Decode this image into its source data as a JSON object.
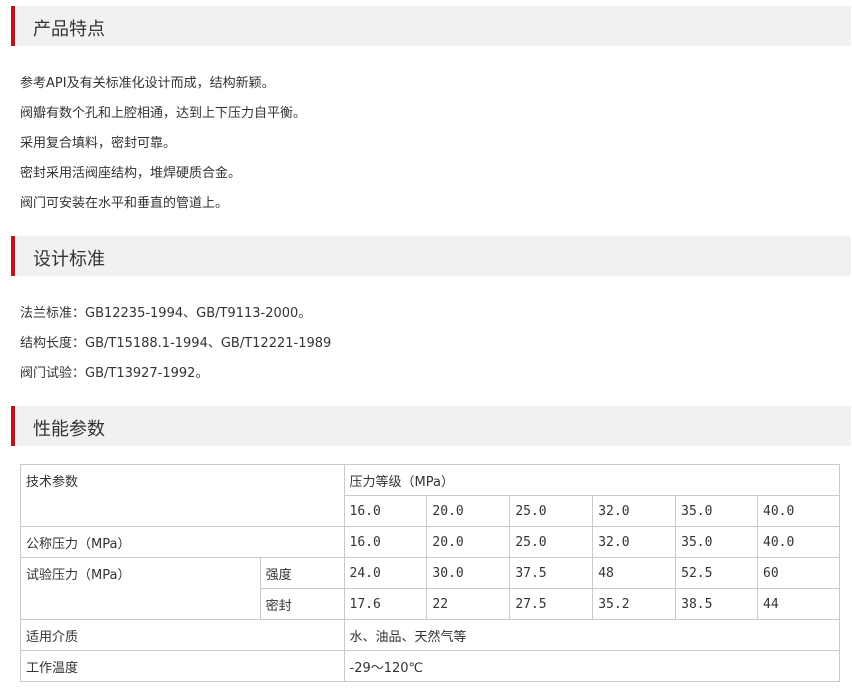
{
  "sections": {
    "features": {
      "title": "产品特点",
      "items": [
        "参考API及有关标准化设计而成，结构新颖。",
        "阀瓣有数个孔和上腔相通，达到上下压力自平衡。",
        "采用复合填料，密封可靠。",
        "密封采用活阀座结构，堆焊硬质合金。",
        "阀门可安装在水平和垂直的管道上。"
      ]
    },
    "standards": {
      "title": "设计标准",
      "items": [
        "法兰标准：GB12235-1994、GB/T9113-2000。",
        "结构长度：GB/T15188.1-1994、GB/T12221-1989",
        "阀门试验：GB/T13927-1992。"
      ]
    },
    "performance": {
      "title": "性能参数"
    }
  },
  "table": {
    "tech_params_label": "技术参数",
    "pressure_class_label": "压力等级（MPa）",
    "pressure_classes": [
      "16.0",
      "20.0",
      "25.0",
      "32.0",
      "35.0",
      "40.0"
    ],
    "nominal_pressure_label": "公称压力（MPa）",
    "nominal_pressure": [
      "16.0",
      "20.0",
      "25.0",
      "32.0",
      "35.0",
      "40.0"
    ],
    "test_pressure_label": "试验压力（MPa）",
    "strength_label": "强度",
    "strength": [
      "24.0",
      "30.0",
      "37.5",
      "48",
      "52.5",
      "60"
    ],
    "seal_label": "密封",
    "seal": [
      "17.6",
      "22",
      "27.5",
      "35.2",
      "38.5",
      "44"
    ],
    "medium_label": "适用介质",
    "medium": "水、油品、天然气等",
    "temperature_label": "工作温度",
    "temperature": "-29～120℃"
  },
  "colors": {
    "accent": "#c1121c",
    "header_bg": "#f1f1f1",
    "border": "#c9c9c9"
  }
}
